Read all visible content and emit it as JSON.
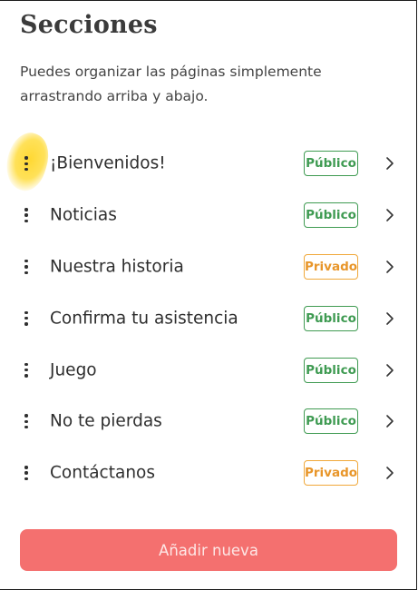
{
  "header": {
    "title": "Secciones",
    "description": "Puedes organizar las páginas simplemente arrastrando arriba y abajo."
  },
  "sections": [
    {
      "label": "¡Bienvenidos!",
      "status": "Público",
      "visibility": "public",
      "highlighted": true
    },
    {
      "label": "Noticias",
      "status": "Público",
      "visibility": "public"
    },
    {
      "label": "Nuestra historia",
      "status": "Privado",
      "visibility": "private"
    },
    {
      "label": "Confirma tu asistencia",
      "status": "Público",
      "visibility": "public"
    },
    {
      "label": "Juego",
      "status": "Público",
      "visibility": "public"
    },
    {
      "label": "No te pierdas",
      "status": "Público",
      "visibility": "public"
    },
    {
      "label": "Contáctanos",
      "status": "Privado",
      "visibility": "private"
    }
  ],
  "icons": {
    "drag": "drag-handle-icon",
    "chevron": "chevron-right-icon"
  },
  "actions": {
    "add_label": "Añadir nueva"
  },
  "colors": {
    "public": "#3f9b52",
    "private": "#f0a83a",
    "button": "#f4706f",
    "highlight": "#ffd628"
  }
}
